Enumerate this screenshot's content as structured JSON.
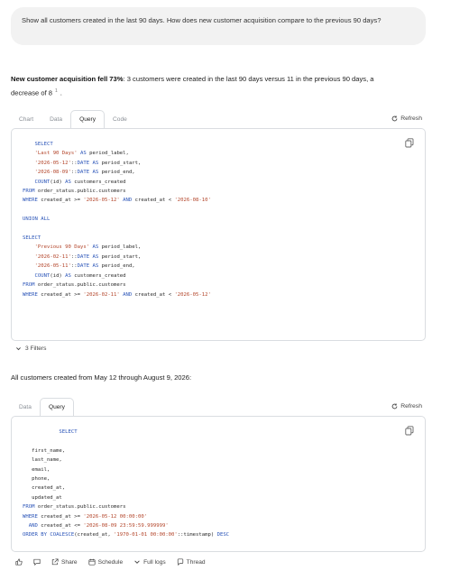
{
  "question": "Show all customers created in the last 90 days. How does new customer acquisition compare to the previous 90 days?",
  "answer": {
    "bold": "New customer acquisition fell 73%",
    "rest": ": 3 customers were created in the last 90 days versus 11 in the previous 90 days, a decrease of 8",
    "cite": "1",
    "end": "."
  },
  "block1": {
    "tabs": [
      "Chart",
      "Data",
      "Query",
      "Code"
    ],
    "active": "Query",
    "refresh": "Refresh"
  },
  "filters_label": "3 Filters",
  "para2": "All customers created from May 12 through August 9, 2026:",
  "block2": {
    "tabs": [
      "Data",
      "Query"
    ],
    "active": "Query",
    "refresh": "Refresh"
  },
  "footer": {
    "share": "Share",
    "schedule": "Schedule",
    "full_logs": "Full logs",
    "thread": "Thread"
  },
  "icons": [
    "copy-icon",
    "refresh-icon",
    "chevron-down-icon",
    "thumbs-up-icon",
    "comment-icon",
    "share-icon",
    "calendar-icon",
    "chat-icon"
  ],
  "colors": {
    "keyword": "#2a54b8",
    "string": "#b3452a",
    "border": "#dadde1"
  }
}
